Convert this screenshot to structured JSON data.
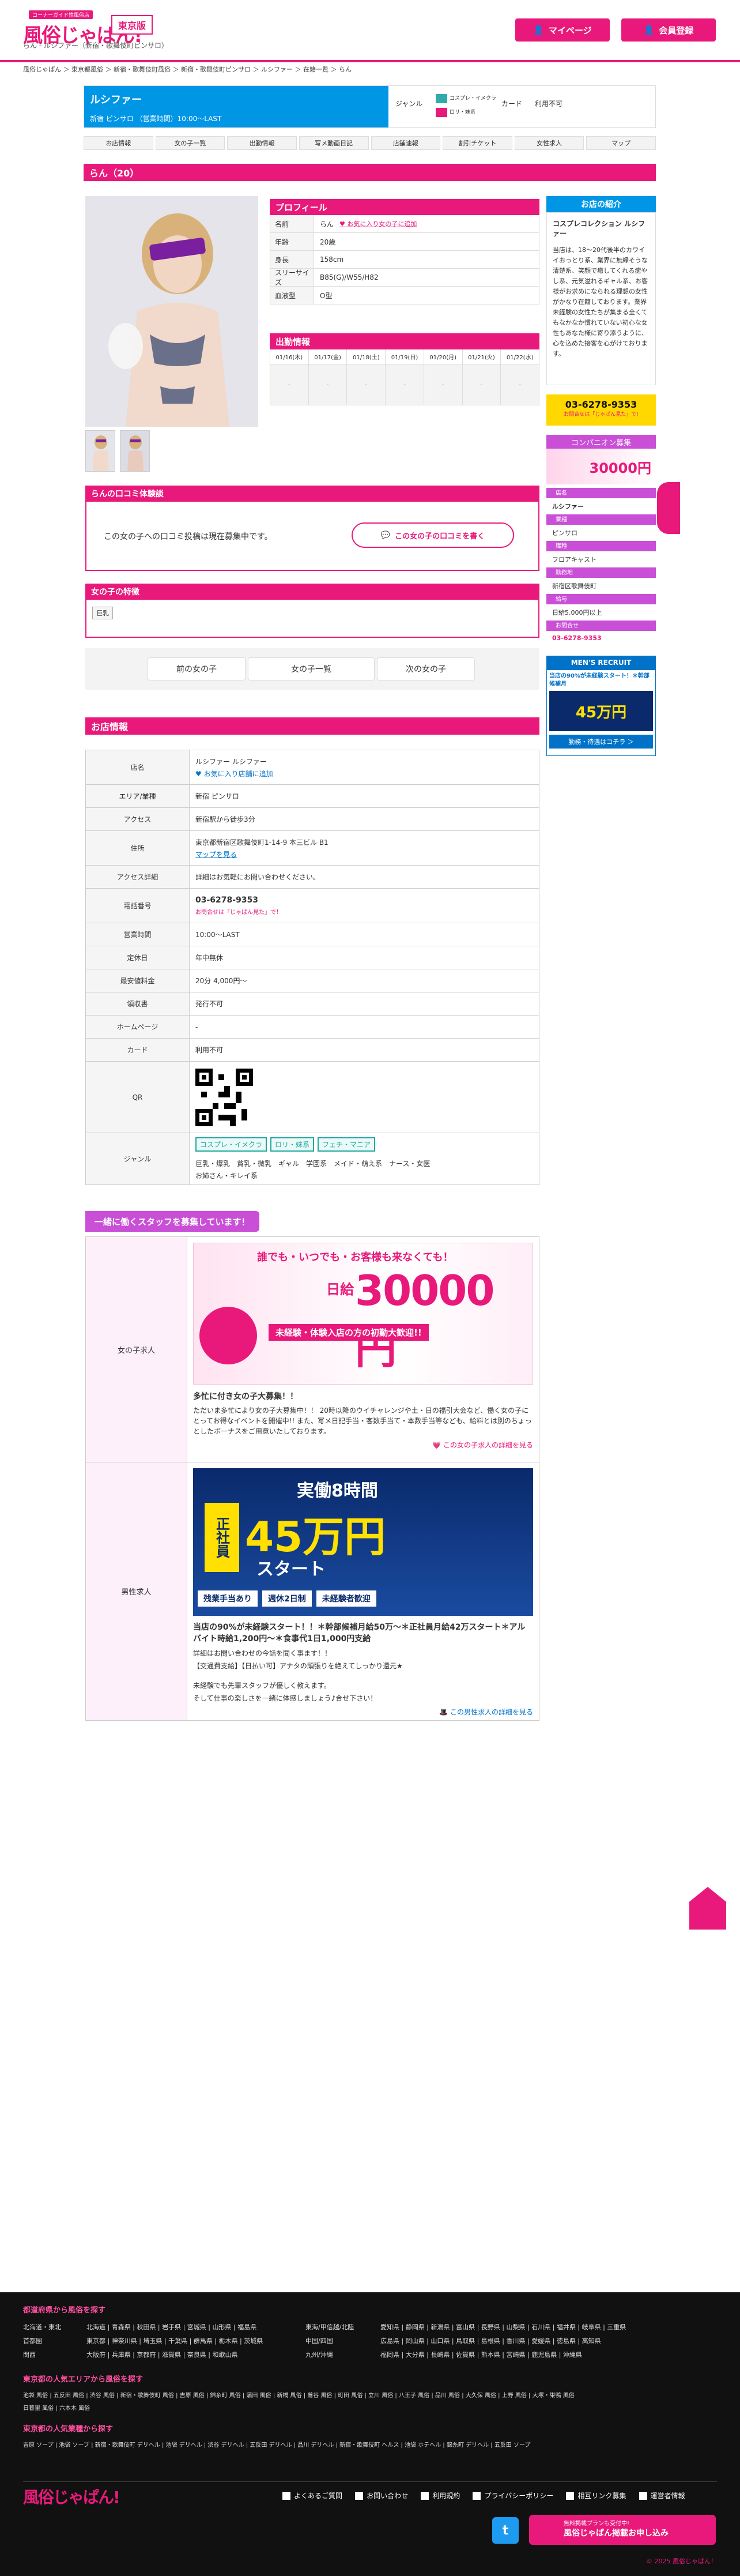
{
  "header": {
    "logo_tag": "コーナーガイド性風俗店",
    "logo_text": "風俗じゃぱん!",
    "region": "東京版",
    "subtitle": "らん - ルシファー（新宿・歌舞伎町ピンサロ）",
    "mypage": "マイページ",
    "register": "会員登録"
  },
  "breadcrumbs": "風俗じゃぱん ＞ 東京都風俗 ＞ 新宿・歌舞伎町風俗 ＞ 新宿・歌舞伎町ピンサロ ＞ ルシファー ＞ 在籍一覧 ＞ らん",
  "shop": {
    "name": "ルシファー",
    "sub": "新宿 ピンサロ （営業時間）10:00〜LAST",
    "genre_label": "ジャンル",
    "genre_badges": [
      "コスプレ・イメクラ",
      "ロリ・妹系"
    ],
    "card_label": "カード",
    "card_value": "利用不可"
  },
  "tabs": [
    "お店情報",
    "女の子一覧",
    "出勤情報",
    "写メ動画日記",
    "店舗速報",
    "割引チケット",
    "女性求人",
    "マップ"
  ],
  "girl": {
    "title": "らん（20）"
  },
  "profile": {
    "head": "プロフィール",
    "rows": [
      {
        "k": "名前",
        "v": "らん",
        "extra": "♥ お気に入り女の子に追加"
      },
      {
        "k": "年齢",
        "v": "20歳"
      },
      {
        "k": "身長",
        "v": "158cm"
      },
      {
        "k": "スリーサイズ",
        "v": "B85(G)/W55/H82"
      },
      {
        "k": "血液型",
        "v": "O型"
      }
    ]
  },
  "schedule": {
    "head": "出勤情報",
    "days": [
      "01/16(木)",
      "01/17(金)",
      "01/18(土)",
      "01/19(日)",
      "01/20(月)",
      "01/21(火)",
      "01/22(水)"
    ],
    "times": [
      "-",
      "-",
      "-",
      "-",
      "-",
      "-",
      "-"
    ]
  },
  "sidebar": {
    "intro_head": "お店の紹介",
    "intro_title": "コスプレコレクション ルシファー",
    "intro_body": "当店は、18〜20代後半のカワイイおっとり系、業界に無縁そうな清楚系、笑顔で癒してくれる癒やし系、元気溢れるギャル系、お客様がお求めになられる理想の女性がかなり在籍しております。業界未経験の女性たちが集まる全くてもなかなか慣れていない初心な女性もあなた様に寄り添うように、心を込めた接客を心がけております。",
    "tel": "03-6278-9353",
    "tel_note": "お問合せは「じゃぱん見た」で!",
    "comp_head": "コンパニオン募集",
    "comp_amount": "30000円",
    "comp_rows": [
      {
        "k": "店名",
        "v": "ルシファー"
      },
      {
        "k": "業種",
        "v": "ピンサロ"
      },
      {
        "k": "職種",
        "v": "フロアキャスト"
      },
      {
        "k": "勤務地",
        "v": "新宿区歌舞伎町"
      },
      {
        "k": "給与",
        "v": "日給5,000円以上"
      },
      {
        "k": "お問合せ",
        "v": "03-6278-9353"
      }
    ],
    "men_head": "MEN'S RECRUIT",
    "men_title": "当店の90%が未経験スタート！＊幹部候補月",
    "men_amount": "45万円",
    "men_btn": "勤務・待遇はコチラ ＞"
  },
  "review": {
    "head": "らんの口コミ体験談",
    "message": "この女の子への口コミ投稿は現在募集中です。",
    "button": "この女の子の口コミを書く"
  },
  "features": {
    "head": "女の子の特徴",
    "tag": "巨乳"
  },
  "nav": {
    "prev": "前の女の子",
    "list": "女の子一覧",
    "next": "次の女の子"
  },
  "store": {
    "head": "お店情報",
    "rows": [
      {
        "k": "店名",
        "v": [
          "ルシファー ルシファー",
          "♥ お気に入り店舗に追加"
        ]
      },
      {
        "k": "エリア/業種",
        "v": [
          "新宿 ピンサロ"
        ]
      },
      {
        "k": "アクセス",
        "v": [
          "新宿駅から徒歩3分"
        ]
      },
      {
        "k": "住所",
        "v": [
          "東京都新宿区歌舞伎町1-14-9 本三ビル B1",
          "マップを見る"
        ]
      },
      {
        "k": "アクセス詳細",
        "v": [
          "詳細はお気軽にお問い合わせください。"
        ]
      },
      {
        "k": "電話番号",
        "v": [
          "03-6278-9353",
          "お問合せは「じゃぱん見た」で！"
        ]
      },
      {
        "k": "営業時間",
        "v": [
          "10:00〜LAST"
        ]
      },
      {
        "k": "定休日",
        "v": [
          "年中無休"
        ]
      },
      {
        "k": "最安値料金",
        "v": [
          "20分 4,000円〜"
        ]
      },
      {
        "k": "領収書",
        "v": [
          "発行不可"
        ]
      },
      {
        "k": "ホームページ",
        "v": [
          "-"
        ]
      },
      {
        "k": "カード",
        "v": [
          "利用不可"
        ]
      }
    ],
    "qr_label": "QR",
    "genre_label": "ジャンル",
    "genre_tags": [
      "コスプレ・イメクラ",
      "ロリ・妹系",
      "フェチ・マニア"
    ],
    "genre_sub": "巨乳・爆乳　貧乳・微乳　ギャル　学園系　メイド・萌え系　ナース・女医",
    "genre_sub2": "お姉さん・キレイ系"
  },
  "recruit": {
    "head": "一緒に働くスタッフを募集しています！",
    "women_label": "女の子求人",
    "women_banner1": "誰でも・いつでも・お客様も来なくても！",
    "women_amount": "30000円",
    "women_daily": "日給",
    "women_sub": "未経験・体験入店の方の初勤大歓迎!!",
    "women_title": "多忙に付き女の子大募集！！",
    "women_body": "ただいま多忙により女の子大募集中！！ 20時以降のウイチャレンジや土・日の福引大会など、働く女の子にとってお得なイベントを開催中!! また、写メ日記手当・客数手当て・本数手当等なども、給料とは別のちょっとしたボーナスをご用意いたしております。",
    "women_link": "この女の子求人の詳細を見る",
    "men_label": "男性求人",
    "men_banner1": "実働8時間",
    "men_amount": "45万円",
    "men_banner2": "正社員",
    "men_banner3": "スタート",
    "men_feats": [
      "残業手当あり",
      "週休2日制",
      "未経験者歓迎"
    ],
    "men_title": "当店の90%が未経験スタート！！＊幹部候補月給50万〜＊正社員月給42万スタート＊アルバイト時給1,200円〜＊食事代1日1,000円支給",
    "men_body1": "詳細はお問い合わせの今話を聞く事ます！！",
    "men_body2": "【交通費支給】【日払い可】アナタの頑張りを絶えてしっかり還元★",
    "men_body3": "未経験でも先輩スタッフが優しく教えます。",
    "men_body4": "そして仕事の楽しさを一緒に体感しましょう♪合せ下さい！",
    "men_link": "この男性求人の詳細を見る"
  },
  "footer": {
    "sec1_head": "都道府県から風俗を探す",
    "sec1_col1": [
      "北海道・東北",
      "首都圏",
      "関西"
    ],
    "sec1_col2": [
      "北海道 | 青森県 | 秋田県 | 岩手県 | 宮城県 | 山形県 | 福島県",
      "東京都 | 神奈川県 | 埼玉県 | 千葉県 | 群馬県 | 栃木県 | 茨城県",
      "大阪府 | 兵庫県 | 京都府 | 滋賀県 | 奈良県 | 和歌山県"
    ],
    "sec1_col3": [
      "東海/甲信越/北陸",
      "中国/四国",
      "九州/沖縄"
    ],
    "sec1_col4": [
      "愛知県 | 静岡県 | 新潟県 | 富山県 | 長野県 | 山梨県 | 石川県 | 福井県 | 岐阜県 | 三重県",
      "広島県 | 岡山県 | 山口県 | 鳥取県 | 島根県 | 香川県 | 愛媛県 | 徳島県 | 高知県",
      "福岡県 | 大分県 | 長崎県 | 佐賀県 | 熊本県 | 宮崎県 | 鹿児島県 | 沖縄県"
    ],
    "sec2_head": "東京都の人気エリアから風俗を探す",
    "sec2_l1": "池袋 風俗 | 五反田 風俗 | 渋谷 風俗 | 新宿・歌舞伎町 風俗 | 吉原 風俗 | 錦糸町 風俗 | 蒲田 風俗 | 新橋 風俗 | 鶯谷 風俗 | 町田 風俗 | 立川 風俗 | 八王子 風俗 | 品川 風俗 | 大久保 風俗 | 上野 風俗 | 大塚・巣鴨 風俗",
    "sec2_l2": "日暮里 風俗 | 六本木 風俗",
    "sec3_head": "東京都の人気業種から探す",
    "sec3_l1": "吉原 ソープ | 池袋 ソープ | 新宿・歌舞伎町 デリヘル | 池袋 デリヘル | 渋谷 デリヘル | 五反田 デリヘル | 品川 デリヘル | 新宿・歌舞伎町 ヘルス | 池袋 ホテヘル | 錦糸町 デリヘル | 五反田 ソープ",
    "links": [
      "よくあるご質問",
      "お問い合わせ",
      "利用規約",
      "プライバシーポリシー",
      "相互リンク募集",
      "運営者情報"
    ],
    "cta_small": "無料掲載プランも受付中!",
    "cta_big": "風俗じゃぱん掲載お申し込み",
    "copyright": "© 2025 風俗じゃぱん！"
  }
}
